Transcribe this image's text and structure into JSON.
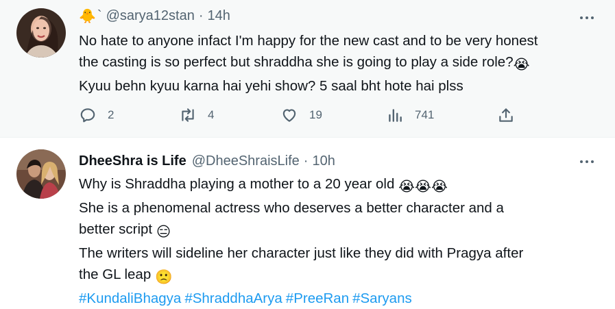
{
  "tweet1": {
    "display_name_emoji": "🐥",
    "backtick": "`",
    "handle": "@sarya12stan",
    "separator": "·",
    "time": "14h",
    "body_lines": [
      "No hate to anyone infact I'm happy for the new cast and to be very honest",
      "the casting is so perfect but shraddha she is going to play a side role?",
      "Kyuu behn kyuu karna hai yehi show? 5 saal bht hote hai plss"
    ],
    "body_emoji_line2": "😭",
    "actions": {
      "replies": "2",
      "retweets": "4",
      "likes": "19",
      "views": "741"
    }
  },
  "tweet2": {
    "display_name": "DheeShra is Life",
    "handle": "@DheeShraisLife",
    "separator": "·",
    "time": "10h",
    "body_lines": [
      "Why is Shraddha playing a mother to a 20 year old",
      "She is a phenomenal actress who deserves a better character and a",
      "better script",
      "The writers will sideline her character just like they did with Pragya after",
      "the GL leap"
    ],
    "emoji_line1": "😭😭😭",
    "emoji_line3": "😑",
    "emoji_line5": "🙁",
    "hashtags": [
      "#KundaliBhagya",
      "#ShraddhaArya",
      "#PreeRan",
      "#Saryans"
    ]
  },
  "colors": {
    "text": "#0f1419",
    "secondary": "#536471",
    "link": "#1d9bf0",
    "highlight_bg": "#f7f9f9"
  },
  "icons": [
    "reply-icon",
    "retweet-icon",
    "like-icon",
    "views-icon",
    "share-icon",
    "more-icon"
  ]
}
